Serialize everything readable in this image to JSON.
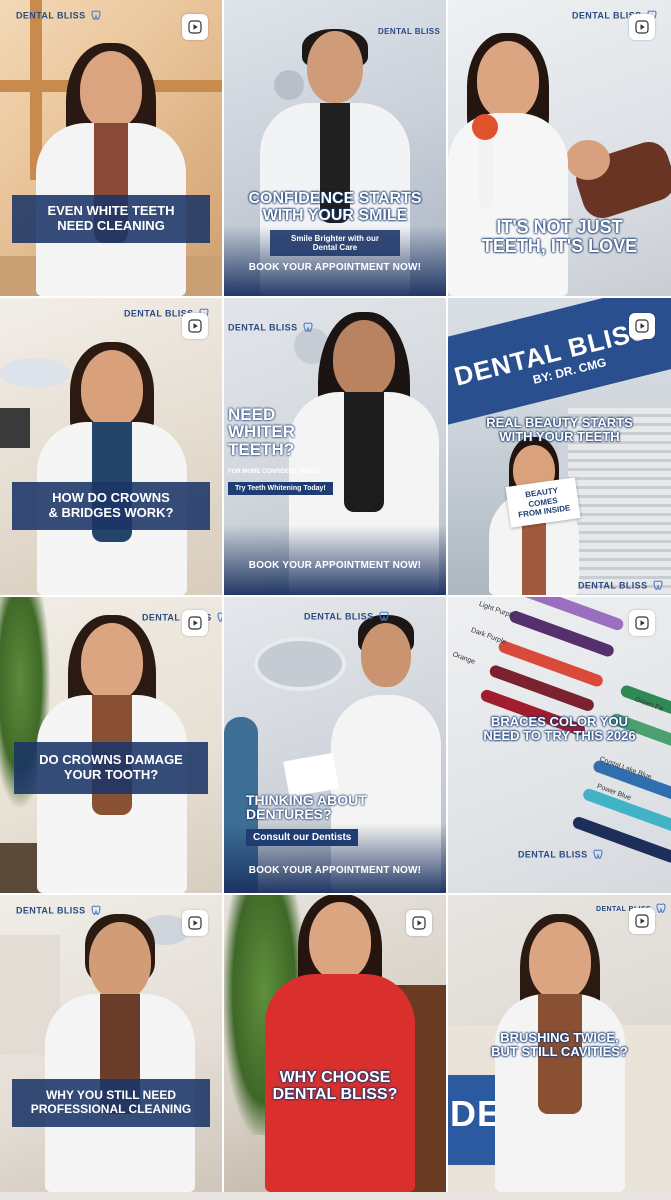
{
  "brand": {
    "name": "DENTAL BLISS",
    "accent": "#1f3d73",
    "band_color": "#1a3466"
  },
  "tiles": [
    {
      "title": "EVEN WHITE TEETH\nNEED CLEANING",
      "style": "band",
      "logo": "DENTAL BLISS",
      "play_icon": "play-icon"
    },
    {
      "title": "CONFIDENCE STARTS\nWITH YOUR SMILE",
      "subtitle": "Smile Brighter with our\nDental Care",
      "cta": "BOOK YOUR APPOINTMENT NOW!",
      "style": "outline",
      "logo": "DENTAL BLISS"
    },
    {
      "title": "IT'S NOT JUST\nTEETH, IT'S LOVE",
      "style": "outline",
      "logo": "DENTAL BLISS",
      "play_icon": "play-icon"
    },
    {
      "title": "HOW DO CROWNS\n& BRIDGES WORK?",
      "style": "band",
      "logo": "DENTAL BLISS",
      "play_icon": "play-icon"
    },
    {
      "title": "NEED\nWHITER\nTEETH?",
      "kicker": "FOR MORE CONFIDENT SMILE!",
      "pill": "Try Teeth Whitening Today!",
      "cta": "BOOK YOUR APPOINTMENT NOW!",
      "style": "left",
      "logo": "DENTAL BLISS"
    },
    {
      "title": "REAL BEAUTY STARTS\nWITH YOUR TEETH",
      "sign": "BEAUTY COMES\nFROM INSIDE",
      "storefront": "DENTAL BLISS",
      "storefront_sub": "BY: DR. CMG",
      "style": "outline",
      "logo": "DENTAL BLISS",
      "play_icon": "play-icon"
    },
    {
      "title": "DO CROWNS DAMAGE\nYOUR TOOTH?",
      "style": "band",
      "logo": "DENTAL BLISS",
      "play_icon": "play-icon"
    },
    {
      "title": "THINKING ABOUT\nDENTURES?",
      "pill": "Consult our Dentists",
      "cta": "BOOK YOUR APPOINTMENT NOW!",
      "style": "left",
      "logo": "DENTAL BLISS"
    },
    {
      "title": "BRACES COLOR YOU\nNEED TO TRY THIS 2026",
      "swatches": [
        "Light Purple",
        "Dark Purple",
        "Orange",
        "Crystal Lake Blue",
        "Power Blue",
        "Green Pe"
      ],
      "style": "outline",
      "logo": "DENTAL BLISS",
      "play_icon": "play-icon"
    },
    {
      "title": "WHY YOU STILL NEED\nPROFESSIONAL CLEANING",
      "style": "band",
      "logo": "DENTAL BLISS",
      "play_icon": "play-icon"
    },
    {
      "title": "WHY CHOOSE\nDENTAL BLISS?",
      "style": "outline",
      "play_icon": "play-icon"
    },
    {
      "title": "BRUSHING TWICE,\nBUT STILL CAVITIES?",
      "counter": "DENTA",
      "style": "outline",
      "logo": "DENTAL BLISS",
      "play_icon": "play-icon"
    }
  ]
}
